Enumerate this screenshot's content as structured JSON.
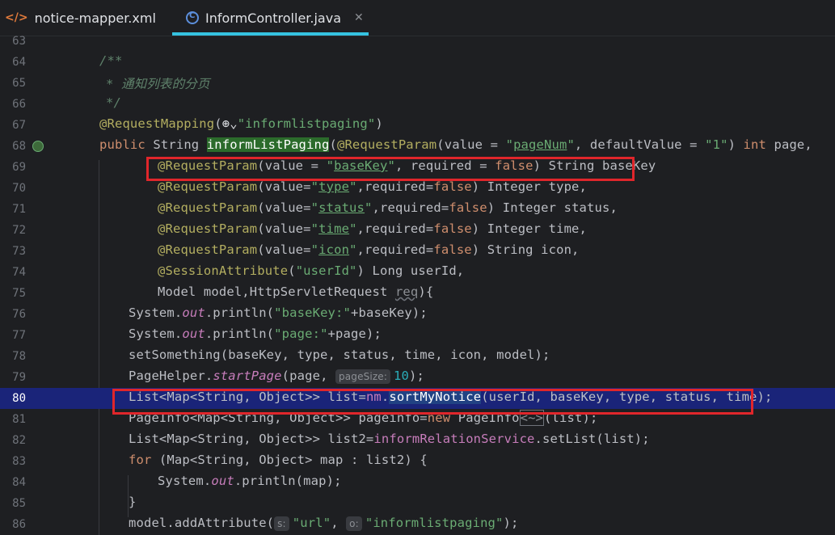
{
  "tabs": [
    {
      "label": "notice-mapper.xml",
      "icon": "xml-file-icon",
      "active": false
    },
    {
      "label": "InformController.java",
      "icon": "java-class-icon",
      "active": true
    }
  ],
  "editor": {
    "current_line": "80",
    "lines": [
      {
        "num": "63"
      },
      {
        "num": "64"
      },
      {
        "num": "65"
      },
      {
        "num": "66"
      },
      {
        "num": "67"
      },
      {
        "num": "68"
      },
      {
        "num": "69"
      },
      {
        "num": "70"
      },
      {
        "num": "71"
      },
      {
        "num": "72"
      },
      {
        "num": "73"
      },
      {
        "num": "74"
      },
      {
        "num": "75"
      },
      {
        "num": "76"
      },
      {
        "num": "77"
      },
      {
        "num": "78"
      },
      {
        "num": "79"
      },
      {
        "num": "80"
      },
      {
        "num": "81"
      },
      {
        "num": "82"
      },
      {
        "num": "83"
      },
      {
        "num": "84"
      },
      {
        "num": "85"
      },
      {
        "num": "86"
      }
    ],
    "hints": {
      "pageSize": "pageSize:",
      "s": "s:",
      "o": "o:"
    }
  },
  "colors": {
    "background": "#1e1f22",
    "current_line": "#1a2479",
    "tab_underline": "#35c2e0",
    "highlight_box": "#e0262b"
  }
}
